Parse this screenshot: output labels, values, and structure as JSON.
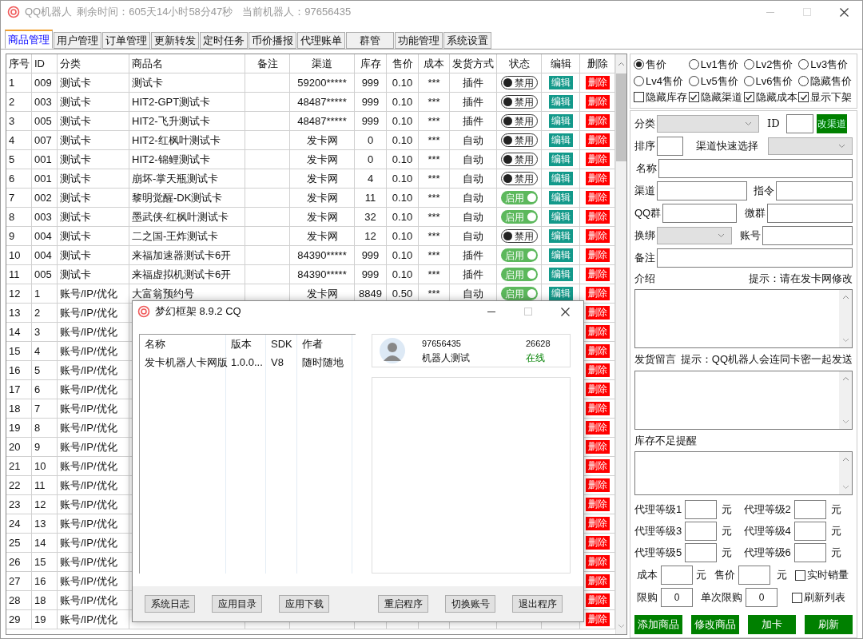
{
  "window": {
    "app_name": "QQ机器人",
    "remaining": "剩余时间：605天14小时58分47秒",
    "current_robot": "当前机器人：97656435"
  },
  "tabs": [
    {
      "label": "商品管理",
      "selected": true
    },
    {
      "label": "用户管理",
      "selected": false
    },
    {
      "label": "订单管理",
      "selected": false
    },
    {
      "label": "更新转发",
      "selected": false
    },
    {
      "label": "定时任务",
      "selected": false
    },
    {
      "label": "币价播报",
      "selected": false
    },
    {
      "label": "代理账单",
      "selected": false
    },
    {
      "label": "群管",
      "selected": false
    },
    {
      "label": "功能管理",
      "selected": false
    },
    {
      "label": "系统设置",
      "selected": false
    }
  ],
  "table": {
    "columns": [
      "序号",
      "ID",
      "分类",
      "商品名",
      "备注",
      "渠道",
      "库存",
      "售价",
      "成本",
      "发货方式",
      "状态",
      "编辑",
      "删除"
    ],
    "rows": [
      {
        "no": "1",
        "id": "009",
        "category": "测试卡",
        "name": "测试卡",
        "channel": "59200*****",
        "stock": "999",
        "price": "0.10",
        "cost": "***",
        "delivery": "插件",
        "status": {
          "label": "禁用",
          "enabled": false
        },
        "edit": "编辑",
        "delete": "删除"
      },
      {
        "no": "2",
        "id": "003",
        "category": "测试卡",
        "name": "HIT2-GPT测试卡",
        "channel": "48487*****",
        "stock": "999",
        "price": "0.10",
        "cost": "***",
        "delivery": "插件",
        "status": {
          "label": "禁用",
          "enabled": false
        },
        "edit": "编辑",
        "delete": "删除"
      },
      {
        "no": "3",
        "id": "005",
        "category": "测试卡",
        "name": "HIT2-飞升测试卡",
        "channel": "48487*****",
        "stock": "999",
        "price": "0.10",
        "cost": "***",
        "delivery": "插件",
        "status": {
          "label": "禁用",
          "enabled": false
        },
        "edit": "编辑",
        "delete": "删除"
      },
      {
        "no": "4",
        "id": "007",
        "category": "测试卡",
        "name": "HIT2-红枫叶测试卡",
        "channel": "发卡网",
        "stock": "0",
        "price": "0.10",
        "cost": "***",
        "delivery": "自动",
        "status": {
          "label": "禁用",
          "enabled": false
        },
        "edit": "编辑",
        "delete": "删除"
      },
      {
        "no": "5",
        "id": "001",
        "category": "测试卡",
        "name": "HIT2-锦鲤测试卡",
        "channel": "发卡网",
        "stock": "0",
        "price": "0.10",
        "cost": "***",
        "delivery": "自动",
        "status": {
          "label": "禁用",
          "enabled": false
        },
        "edit": "编辑",
        "delete": "删除"
      },
      {
        "no": "6",
        "id": "001",
        "category": "测试卡",
        "name": "崩坏-掌天瓶测试卡",
        "channel": "发卡网",
        "stock": "4",
        "price": "0.10",
        "cost": "***",
        "delivery": "自动",
        "status": {
          "label": "禁用",
          "enabled": false
        },
        "edit": "编辑",
        "delete": "删除"
      },
      {
        "no": "7",
        "id": "002",
        "category": "测试卡",
        "name": "黎明觉醒-DK测试卡",
        "channel": "发卡网",
        "stock": "11",
        "price": "0.10",
        "cost": "***",
        "delivery": "自动",
        "status": {
          "label": "启用",
          "enabled": true
        },
        "edit": "编辑",
        "delete": "删除"
      },
      {
        "no": "8",
        "id": "003",
        "category": "测试卡",
        "name": "墨武侠-红枫叶测试卡",
        "channel": "发卡网",
        "stock": "32",
        "price": "0.10",
        "cost": "***",
        "delivery": "自动",
        "status": {
          "label": "启用",
          "enabled": true
        },
        "edit": "编辑",
        "delete": "删除"
      },
      {
        "no": "9",
        "id": "004",
        "category": "测试卡",
        "name": "二之国-王炸测试卡",
        "channel": "发卡网",
        "stock": "12",
        "price": "0.10",
        "cost": "***",
        "delivery": "自动",
        "status": {
          "label": "禁用",
          "enabled": false
        },
        "edit": "编辑",
        "delete": "删除"
      },
      {
        "no": "10",
        "id": "004",
        "category": "测试卡",
        "name": "来福加速器测试卡6开",
        "channel": "84390*****",
        "stock": "999",
        "price": "0.10",
        "cost": "***",
        "delivery": "插件",
        "status": {
          "label": "启用",
          "enabled": true
        },
        "edit": "编辑",
        "delete": "删除"
      },
      {
        "no": "11",
        "id": "005",
        "category": "测试卡",
        "name": "来福虚拟机测试卡6开",
        "channel": "84390*****",
        "stock": "999",
        "price": "0.10",
        "cost": "***",
        "delivery": "插件",
        "status": {
          "label": "启用",
          "enabled": true
        },
        "edit": "编辑",
        "delete": "删除"
      },
      {
        "no": "12",
        "id": "1",
        "category": "账号/IP/优化",
        "name": "大富翁预约号",
        "channel": "发卡网",
        "stock": "8849",
        "price": "0.50",
        "cost": "***",
        "delivery": "自动",
        "status": {
          "label": "启用",
          "enabled": true
        },
        "edit": "编辑",
        "delete": "删除"
      },
      {
        "no": "13",
        "id": "2",
        "category": "账号/IP/优化",
        "delete": "删除"
      },
      {
        "no": "14",
        "id": "3",
        "category": "账号/IP/优化",
        "delete": "删除"
      },
      {
        "no": "15",
        "id": "4",
        "category": "账号/IP/优化",
        "delete": "删除"
      },
      {
        "no": "16",
        "id": "5",
        "category": "账号/IP/优化",
        "delete": "删除"
      },
      {
        "no": "17",
        "id": "6",
        "category": "账号/IP/优化",
        "delete": "删除"
      },
      {
        "no": "18",
        "id": "7",
        "category": "账号/IP/优化",
        "delete": "删除"
      },
      {
        "no": "19",
        "id": "8",
        "category": "账号/IP/优化",
        "delete": "删除"
      },
      {
        "no": "20",
        "id": "9",
        "category": "账号/IP/优化",
        "delete": "删除"
      },
      {
        "no": "21",
        "id": "10",
        "category": "账号/IP/优化",
        "delete": "删除"
      },
      {
        "no": "22",
        "id": "11",
        "category": "账号/IP/优化",
        "delete": "删除"
      },
      {
        "no": "23",
        "id": "12",
        "category": "账号/IP/优化",
        "delete": "删除"
      },
      {
        "no": "24",
        "id": "13",
        "category": "账号/IP/优化",
        "delete": "删除"
      },
      {
        "no": "25",
        "id": "14",
        "category": "账号/IP/优化",
        "delete": "删除"
      },
      {
        "no": "26",
        "id": "15",
        "category": "账号/IP/优化",
        "delete": "删除"
      },
      {
        "no": "27",
        "id": "16",
        "category": "账号/IP/优化",
        "delete": "删除"
      },
      {
        "no": "28",
        "id": "18",
        "category": "账号/IP/优化",
        "delete": "删除"
      },
      {
        "no": "29",
        "id": "19",
        "category": "账号/IP/优化",
        "delete": "删除"
      }
    ]
  },
  "display_options": {
    "radios": [
      {
        "label": "售价",
        "selected": true
      },
      {
        "label": "Lv1售价",
        "selected": false
      },
      {
        "label": "Lv2售价",
        "selected": false
      },
      {
        "label": "Lv3售价",
        "selected": false
      },
      {
        "label": "Lv4售价",
        "selected": false
      },
      {
        "label": "Lv5售价",
        "selected": false
      },
      {
        "label": "Lv6售价",
        "selected": false
      },
      {
        "label": "隐藏售价",
        "selected": false
      }
    ],
    "checkboxes": [
      {
        "label": "隐藏库存",
        "checked": false
      },
      {
        "label": "隐藏渠道",
        "checked": true
      },
      {
        "label": "隐藏成本",
        "checked": true
      },
      {
        "label": "显示下架",
        "checked": true
      }
    ]
  },
  "form": {
    "category_label": "分类",
    "id_label": "ID",
    "change_channel_button": "改渠道",
    "sort_label": "排序",
    "quick_channel_label": "渠道快速选择",
    "name_label": "名称",
    "channel_label": "渠道",
    "command_label": "指令",
    "qq_group_label": "QQ群",
    "wechat_group_label": "微群",
    "rebind_label": "换绑",
    "account_label": "账号",
    "note_label": "备注",
    "intro_label": "介绍",
    "intro_hint": "提示：请在发卡网修改",
    "delivery_msg_label": "发货留言",
    "delivery_msg_hint": "提示：QQ机器人会连同卡密一起发送",
    "low_stock_label": "库存不足提醒",
    "agent_levels": [
      {
        "label": "代理等级1",
        "unit": "元"
      },
      {
        "label": "代理等级2",
        "unit": "元"
      },
      {
        "label": "代理等级3",
        "unit": "元"
      },
      {
        "label": "代理等级4",
        "unit": "元"
      },
      {
        "label": "代理等级5",
        "unit": "元"
      },
      {
        "label": "代理等级6",
        "unit": "元"
      }
    ],
    "cost_label": "成本",
    "cost_unit": "元",
    "price_label": "售价",
    "price_unit": "元",
    "realtime_sales": {
      "label": "实时销量",
      "checked": false
    },
    "limit_label": "限购",
    "limit_value": "0",
    "single_limit_label": "单次限购",
    "single_limit_value": "0",
    "refresh_list": {
      "label": "刷新列表",
      "checked": false
    },
    "buttons": [
      "添加商品",
      "修改商品",
      "加卡",
      "刷新"
    ]
  },
  "dialog": {
    "title": "梦幻框架 8.9.2 CQ",
    "plugins": {
      "columns": [
        "名称",
        "版本",
        "SDK",
        "作者"
      ],
      "rows": [
        [
          "发卡机器人卡网版",
          "1.0.0...",
          "V8",
          "随时随地"
        ]
      ]
    },
    "account": {
      "qq": "97656435",
      "nickname": "机器人测试",
      "number": "26628",
      "status": "在线"
    },
    "buttons": [
      "系统日志",
      "应用目录",
      "应用下载",
      "重启程序",
      "切换账号",
      "退出程序"
    ]
  }
}
